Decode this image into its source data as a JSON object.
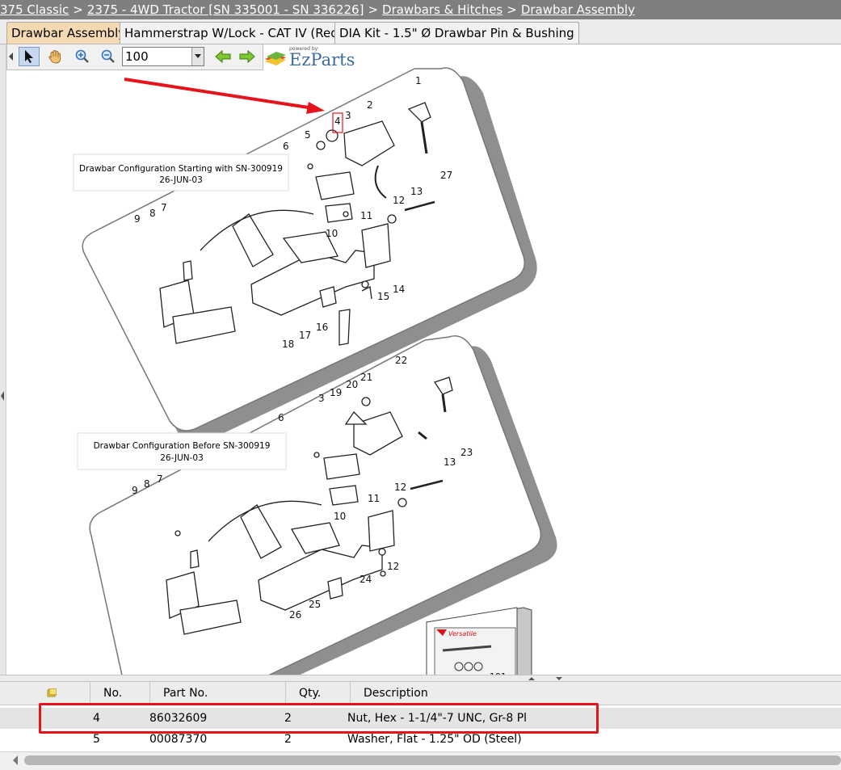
{
  "breadcrumb": {
    "items": [
      "375 Classic",
      "2375 - 4WD Tractor [SN 335001 - SN 336226]",
      "Drawbars & Hitches",
      "Drawbar Assembly"
    ],
    "separator": ">"
  },
  "tabs": [
    {
      "label": "Drawbar Assembly",
      "active": true
    },
    {
      "label": "Hammerstrap W/Lock - CAT IV (Red)",
      "active": false
    },
    {
      "label": "DIA Kit - 1.5\" Ø Drawbar Pin & Bushing",
      "active": false
    }
  ],
  "toolbar": {
    "zoom_value": "100",
    "tools": [
      "pointer-icon",
      "hand-pan-icon",
      "zoom-in-icon",
      "zoom-out-icon",
      "back-arrow-icon",
      "forward-arrow-icon"
    ]
  },
  "logo": {
    "powered_by": "powered by:",
    "name": "EzParts"
  },
  "diagram": {
    "caption_top": {
      "line1": "Drawbar Configuration Starting with SN-300919",
      "line2": "26-JUN-03"
    },
    "caption_bottom": {
      "line1": "Drawbar Configuration Before SN-300919",
      "line2": "26-JUN-03"
    },
    "callouts_top": [
      "1",
      "2",
      "3",
      "4",
      "5",
      "6",
      "7",
      "8",
      "9",
      "10",
      "11",
      "12",
      "13",
      "14",
      "15",
      "16",
      "17",
      "18",
      "27"
    ],
    "callouts_bottom": [
      "3",
      "6",
      "7",
      "8",
      "9",
      "10",
      "11",
      "12",
      "12",
      "13",
      "19",
      "20",
      "21",
      "22",
      "23",
      "24",
      "25",
      "26"
    ],
    "box_callout": "101",
    "brand_label": "Versatile"
  },
  "grid": {
    "columns": [
      "No.",
      "Part No.",
      "Qty.",
      "Description"
    ],
    "rows": [
      {
        "no": "4",
        "part": "86032609",
        "qty": "2",
        "desc": "Nut, Hex - 1-1/4\"-7 UNC, Gr-8 Pl",
        "selected": true
      },
      {
        "no": "5",
        "part": "00087370",
        "qty": "2",
        "desc": "Washer, Flat - 1.25\" OD (Steel)",
        "selected": false
      }
    ]
  },
  "colors": {
    "breadcrumb_bg": "#7f7f7f",
    "active_tab": "#f4d9b3",
    "annotation_red": "#e5141b",
    "logo_blue": "#3d6a9b"
  }
}
